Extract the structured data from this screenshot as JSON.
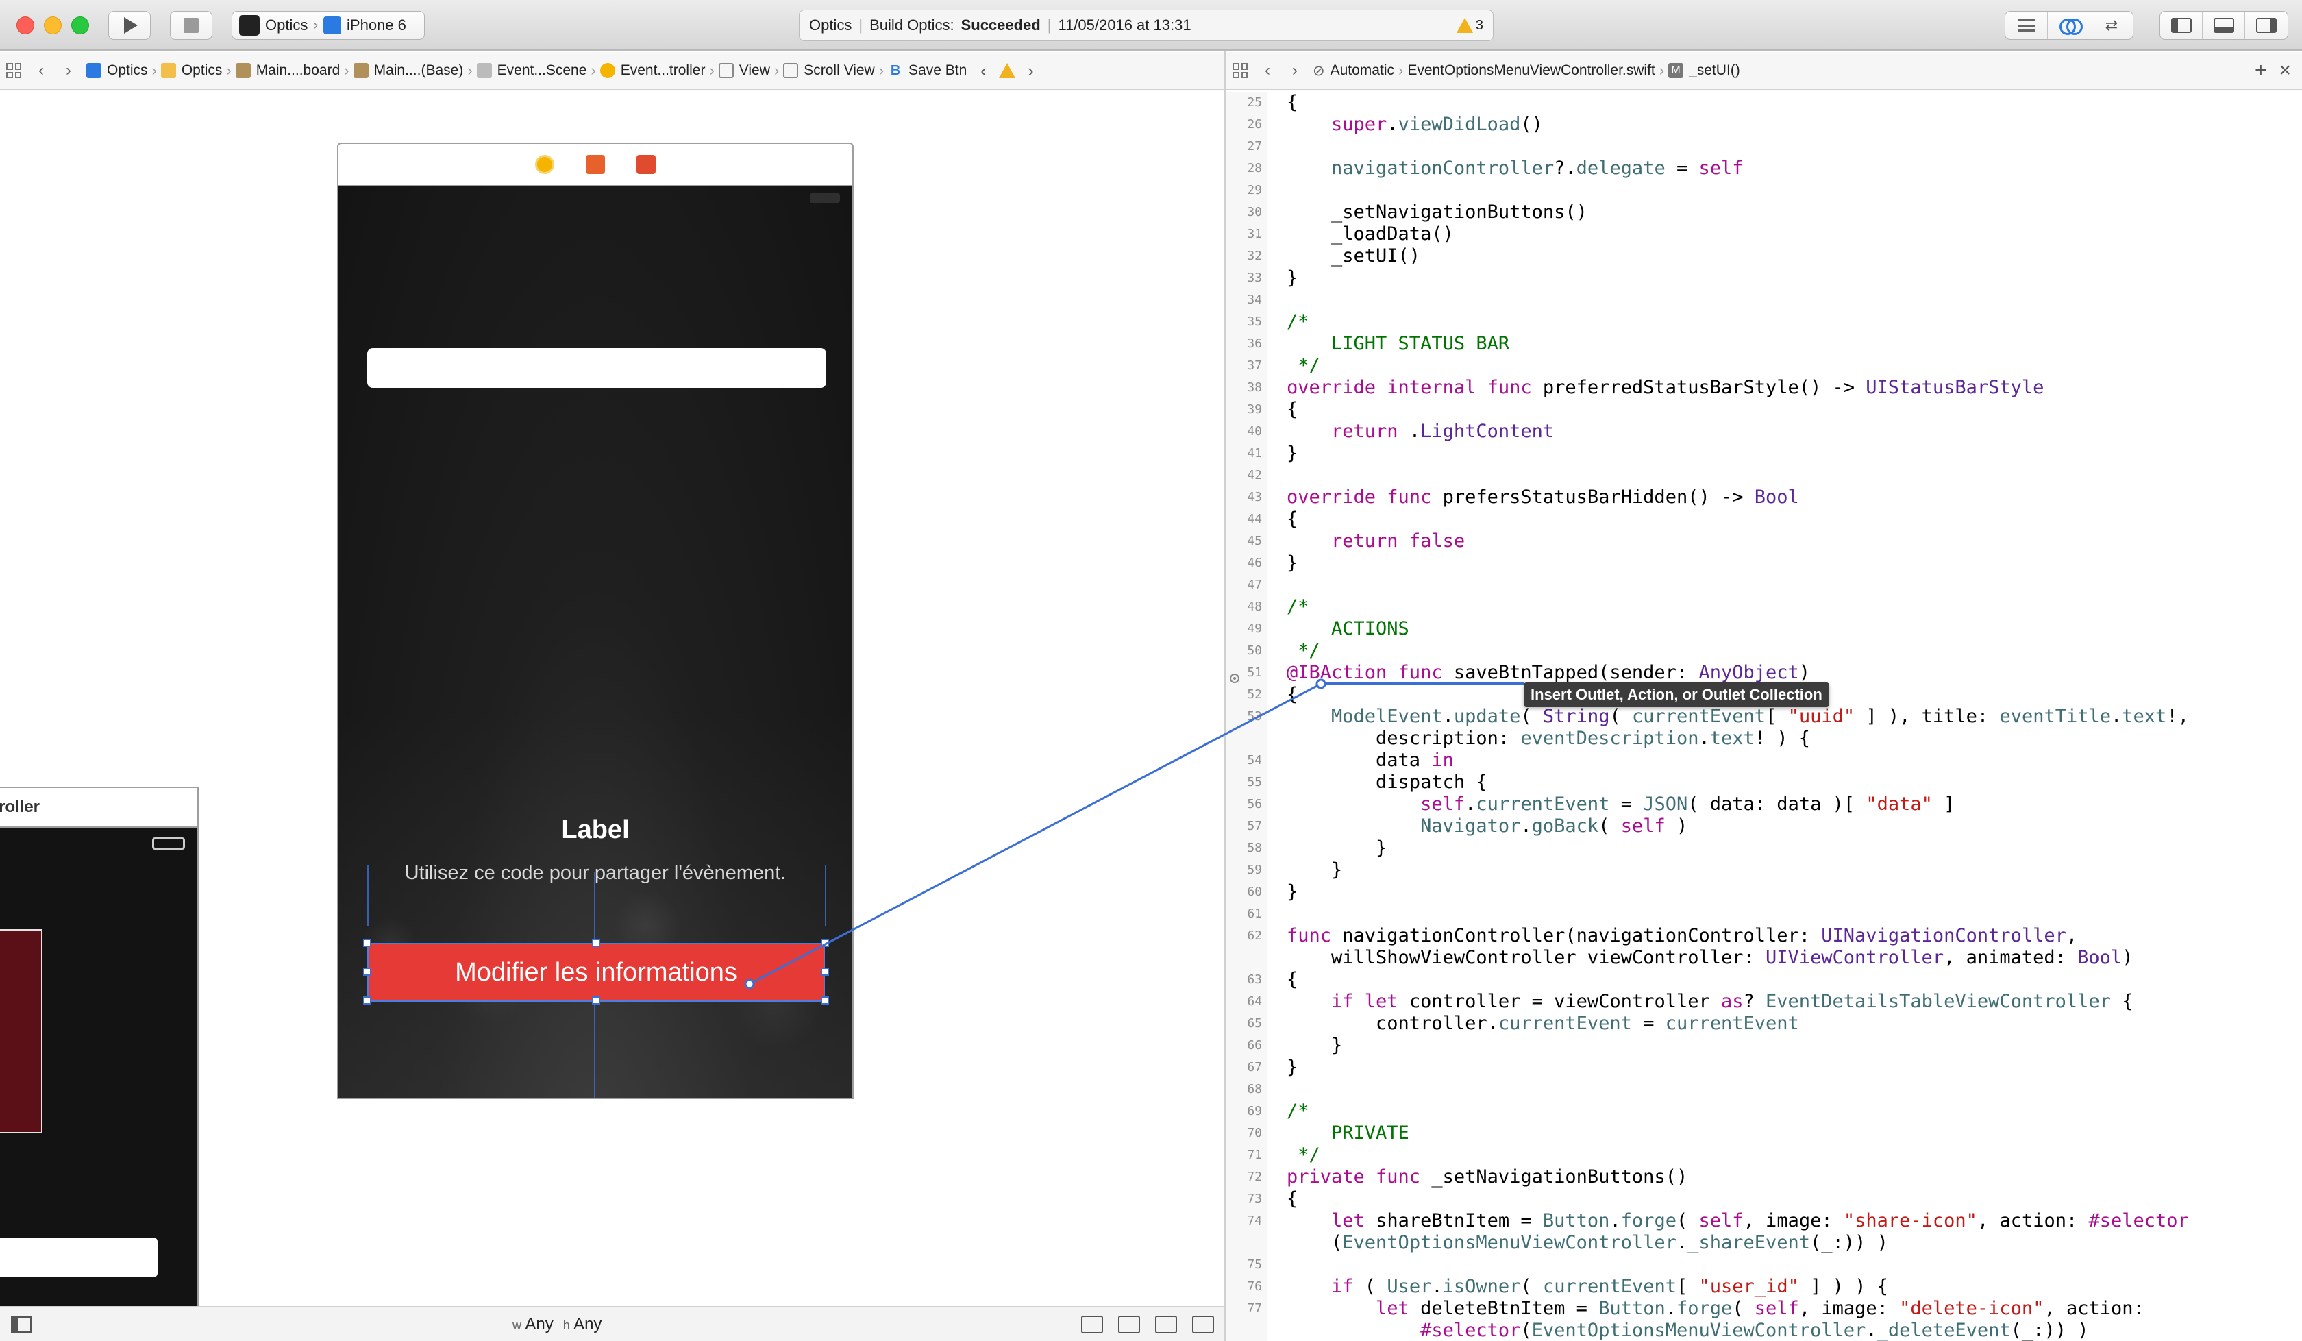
{
  "toolbar": {
    "scheme_app": "Optics",
    "scheme_device": "iPhone 6",
    "activity_project": "Optics",
    "activity_status_prefix": "Build Optics:",
    "activity_status": "Succeeded",
    "activity_date": "11/05/2016 at 13:31",
    "warnings_count": "3"
  },
  "left_jumpbar": {
    "crumbs": [
      "Optics",
      "Optics",
      "Main....board",
      "Main....(Base)",
      "Event...Scene",
      "Event...troller",
      "View",
      "Scroll View",
      "Save Btn"
    ]
  },
  "right_jumpbar": {
    "mode": "Automatic",
    "file": "EventOptionsMenuViewController.swift",
    "symbol": "_setUI()"
  },
  "storyboard": {
    "scene_label": "Label",
    "scene_description": "Utilisez ce code pour partager l'évènement.",
    "save_button_label": "Modifier les informations",
    "scene2_title": "roller",
    "size_class_w_prefix": "w",
    "size_class_w": "Any",
    "size_class_h_prefix": "h",
    "size_class_h": "Any"
  },
  "tooltip": "Insert Outlet, Action, or Outlet Collection",
  "code_lines": [
    {
      "n": "25",
      "html": "{"
    },
    {
      "n": "26",
      "html": "    <span class=\"k\">super</span>.<span class=\"m\">viewDidLoad</span>()"
    },
    {
      "n": "27",
      "html": ""
    },
    {
      "n": "28",
      "html": "    <span class=\"m\">navigationController</span>?.<span class=\"m\">delegate</span> = <span class=\"k\">self</span>"
    },
    {
      "n": "29",
      "html": ""
    },
    {
      "n": "30",
      "html": "    _setNavigationButtons()"
    },
    {
      "n": "31",
      "html": "    _loadData()"
    },
    {
      "n": "32",
      "html": "    _setUI()"
    },
    {
      "n": "33",
      "html": "}"
    },
    {
      "n": "34",
      "html": ""
    },
    {
      "n": "35",
      "html": "<span class=\"c\">/*</span>"
    },
    {
      "n": "36",
      "html": "<span class=\"c\">    LIGHT STATUS BAR</span>"
    },
    {
      "n": "37",
      "html": "<span class=\"c\"> */</span>"
    },
    {
      "n": "38",
      "html": "<span class=\"k\">override internal func</span> preferredStatusBarStyle() -&gt; <span class=\"t\">UIStatusBarStyle</span>"
    },
    {
      "n": "39",
      "html": "{"
    },
    {
      "n": "40",
      "html": "    <span class=\"k\">return</span> .<span class=\"t\">LightContent</span>"
    },
    {
      "n": "41",
      "html": "}"
    },
    {
      "n": "42",
      "html": ""
    },
    {
      "n": "43",
      "html": "<span class=\"k\">override func</span> prefersStatusBarHidden() -&gt; <span class=\"t\">Bool</span>"
    },
    {
      "n": "44",
      "html": "{"
    },
    {
      "n": "45",
      "html": "    <span class=\"k\">return false</span>"
    },
    {
      "n": "46",
      "html": "}"
    },
    {
      "n": "47",
      "html": ""
    },
    {
      "n": "48",
      "html": "<span class=\"c\">/*</span>"
    },
    {
      "n": "49",
      "html": "<span class=\"c\">    ACTIONS</span>"
    },
    {
      "n": "50",
      "html": "<span class=\"c\"> */</span>"
    },
    {
      "n": "51",
      "html": "<span class=\"k\">@IBAction func</span> saveBtnTapped(sender: <span class=\"t\">AnyObject</span>)"
    },
    {
      "n": "52",
      "html": "{"
    },
    {
      "n": "53",
      "html": "    <span class=\"m\">ModelEvent</span>.<span class=\"m\">update</span>( <span class=\"t\">String</span>( <span class=\"m\">currentEvent</span>[ <span class=\"s\">\"uuid\"</span> ] ), title: <span class=\"m\">eventTitle</span>.<span class=\"m\">text</span>!,"
    },
    {
      "n": "",
      "html": "        description: <span class=\"m\">eventDescription</span>.<span class=\"m\">text</span>! ) {"
    },
    {
      "n": "54",
      "html": "        data <span class=\"k\">in</span>"
    },
    {
      "n": "55",
      "html": "        dispatch {"
    },
    {
      "n": "56",
      "html": "            <span class=\"k\">self</span>.<span class=\"m\">currentEvent</span> = <span class=\"m\">JSON</span>( data: data )[ <span class=\"s\">\"data\"</span> ]"
    },
    {
      "n": "57",
      "html": "            <span class=\"m\">Navigator</span>.<span class=\"m\">goBack</span>( <span class=\"k\">self</span> )"
    },
    {
      "n": "58",
      "html": "        }"
    },
    {
      "n": "59",
      "html": "    }"
    },
    {
      "n": "60",
      "html": "}"
    },
    {
      "n": "61",
      "html": ""
    },
    {
      "n": "62",
      "html": "<span class=\"k\">func</span> navigationController(navigationController: <span class=\"t\">UINavigationController</span>,"
    },
    {
      "n": "",
      "html": "    willShowViewController viewController: <span class=\"t\">UIViewController</span>, animated: <span class=\"t\">Bool</span>)"
    },
    {
      "n": "63",
      "html": "{"
    },
    {
      "n": "64",
      "html": "    <span class=\"k\">if let</span> controller = viewController <span class=\"k\">as</span>? <span class=\"m\">EventDetailsTableViewController</span> {"
    },
    {
      "n": "65",
      "html": "        controller.<span class=\"m\">currentEvent</span> = <span class=\"m\">currentEvent</span>"
    },
    {
      "n": "66",
      "html": "    }"
    },
    {
      "n": "67",
      "html": "}"
    },
    {
      "n": "68",
      "html": ""
    },
    {
      "n": "69",
      "html": "<span class=\"c\">/*</span>"
    },
    {
      "n": "70",
      "html": "<span class=\"c\">    PRIVATE</span>"
    },
    {
      "n": "71",
      "html": "<span class=\"c\"> */</span>"
    },
    {
      "n": "72",
      "html": "<span class=\"k\">private func</span> _setNavigationButtons()"
    },
    {
      "n": "73",
      "html": "{"
    },
    {
      "n": "74",
      "html": "    <span class=\"k\">let</span> shareBtnItem = <span class=\"m\">Button</span>.<span class=\"m\">forge</span>( <span class=\"k\">self</span>, image: <span class=\"s\">\"share-icon\"</span>, action: <span class=\"k\">#selector</span>"
    },
    {
      "n": "",
      "html": "    (<span class=\"m\">EventOptionsMenuViewController</span>.<span class=\"m\">_shareEvent</span>(_:)) )"
    },
    {
      "n": "75",
      "html": ""
    },
    {
      "n": "76",
      "html": "    <span class=\"k\">if</span> ( <span class=\"m\">User</span>.<span class=\"m\">isOwner</span>( <span class=\"m\">currentEvent</span>[ <span class=\"s\">\"user_id\"</span> ] ) ) {"
    },
    {
      "n": "77",
      "html": "        <span class=\"k\">let</span> deleteBtnItem = <span class=\"m\">Button</span>.<span class=\"m\">forge</span>( <span class=\"k\">self</span>, image: <span class=\"s\">\"delete-icon\"</span>, action:"
    },
    {
      "n": "",
      "html": "            <span class=\"k\">#selector</span>(<span class=\"m\">EventOptionsMenuViewController</span>.<span class=\"m\">_deleteEvent</span>(_:)) )"
    }
  ]
}
